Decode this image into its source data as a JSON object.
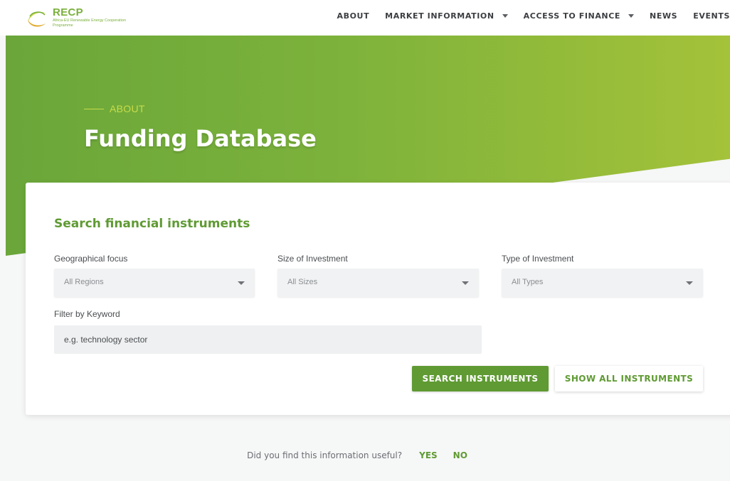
{
  "header": {
    "logo": {
      "title": "RECP",
      "subtitle": "Africa-EU Renewable Energy Cooperation Programme"
    },
    "nav": [
      {
        "label": "ABOUT",
        "dropdown": false
      },
      {
        "label": "MARKET INFORMATION",
        "dropdown": true
      },
      {
        "label": "ACCESS TO FINANCE",
        "dropdown": true
      },
      {
        "label": "NEWS",
        "dropdown": false
      },
      {
        "label": "EVENTS",
        "dropdown": false
      }
    ]
  },
  "hero": {
    "eyebrow": "ABOUT",
    "title": "Funding Database"
  },
  "search": {
    "title": "Search financial instruments",
    "geo": {
      "label": "Geographical focus",
      "value": "All Regions"
    },
    "size": {
      "label": "Size of Investment",
      "value": "All Sizes"
    },
    "type": {
      "label": "Type of Investment",
      "value": "All Types"
    },
    "keyword": {
      "label": "Filter by Keyword",
      "placeholder": "e.g. technology sector",
      "value": ""
    },
    "search_button": "SEARCH INSTRUMENTS",
    "show_all_button": "SHOW ALL INSTRUMENTS"
  },
  "feedback": {
    "question": "Did you find this information useful?",
    "yes": "YES",
    "no": "NO"
  },
  "colors": {
    "brand_green": "#5f9a33",
    "hero_start": "#6aa63a",
    "hero_end": "#a4c23a",
    "eyebrow": "#c8dc4a"
  }
}
